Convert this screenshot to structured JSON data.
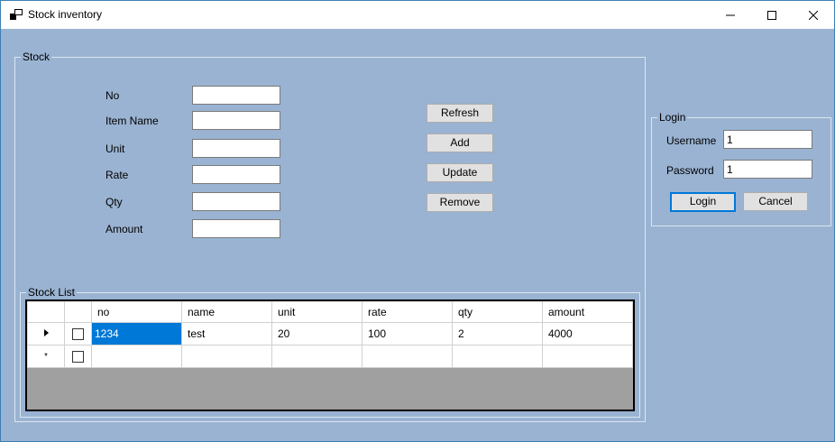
{
  "window": {
    "title": "Stock inventory",
    "minimize": "—",
    "maximize": "☐",
    "close": "✕"
  },
  "stock": {
    "group_title": "Stock",
    "fields": {
      "no": {
        "label": "No",
        "value": ""
      },
      "item_name": {
        "label": "Item Name",
        "value": ""
      },
      "unit": {
        "label": "Unit",
        "value": ""
      },
      "rate": {
        "label": "Rate",
        "value": ""
      },
      "qty": {
        "label": "Qty",
        "value": ""
      },
      "amount": {
        "label": "Amount",
        "value": ""
      }
    },
    "buttons": {
      "refresh": "Refresh",
      "add": "Add",
      "update": "Update",
      "remove": "Remove"
    }
  },
  "stock_list": {
    "group_title": "Stock List",
    "columns": [
      "no",
      "name",
      "unit",
      "rate",
      "qty",
      "amount"
    ],
    "rows": [
      {
        "indicator": "▶",
        "no": "1234",
        "name": "test",
        "unit": "20",
        "rate": "100",
        "qty": "2",
        "amount": "4000"
      }
    ],
    "new_row_indicator": "*"
  },
  "login": {
    "group_title": "Login",
    "username_label": "Username",
    "username_value": "1",
    "password_label": "Password",
    "password_value": "1",
    "login_button": "Login",
    "cancel_button": "Cancel"
  }
}
